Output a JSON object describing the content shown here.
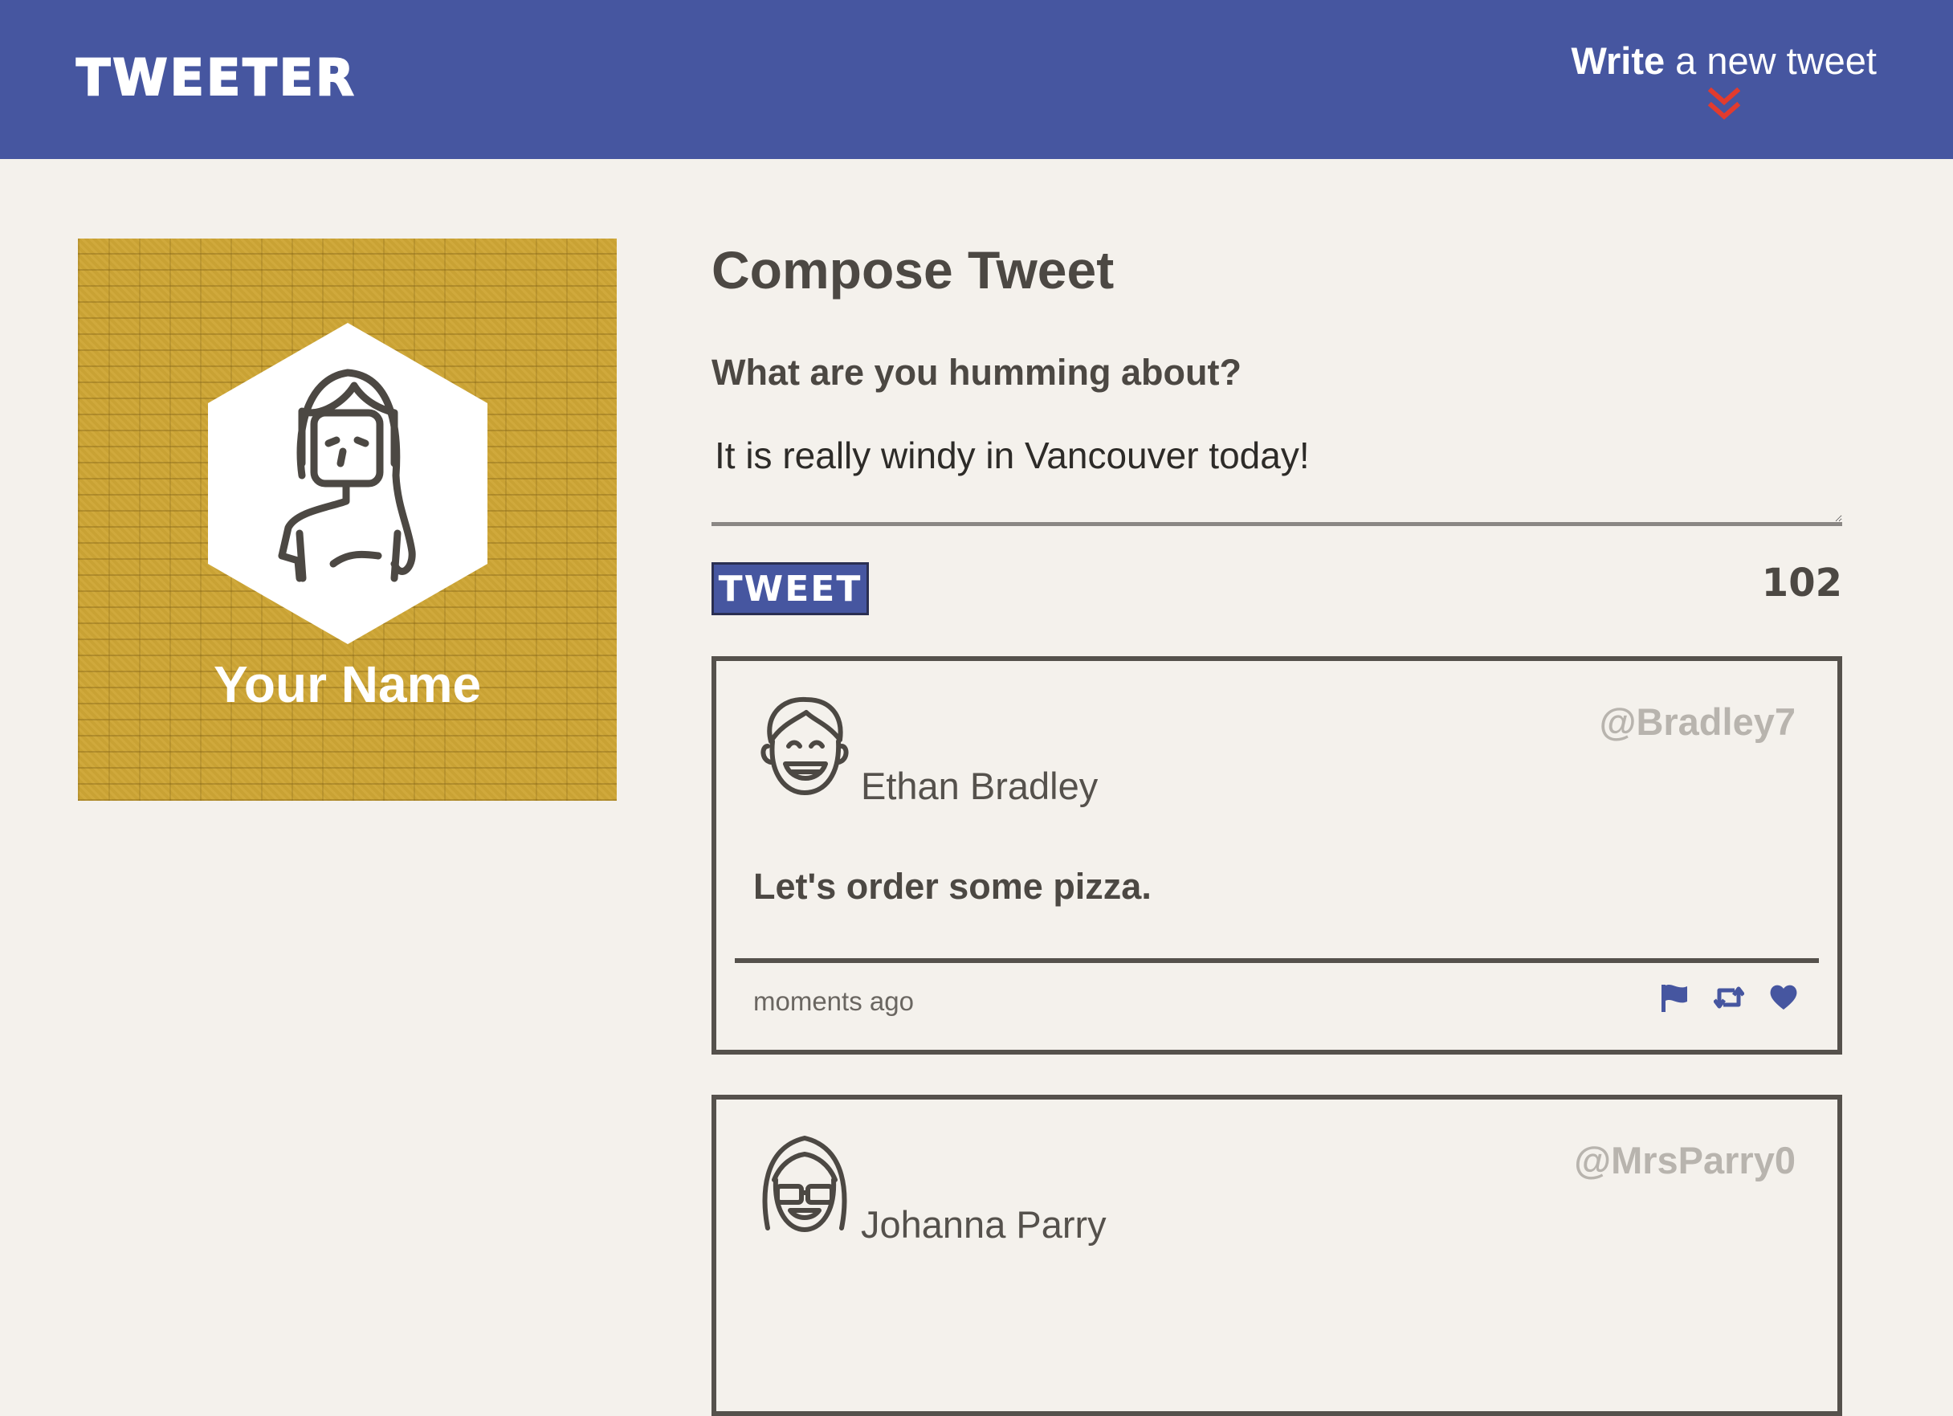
{
  "nav": {
    "brand": "TWEETER",
    "compose_bold": "Write",
    "compose_rest": " a new tweet",
    "arrow_icon": "double-chevron-down-icon"
  },
  "profile": {
    "name": "Your Name",
    "avatar_icon": "woman-avatar-icon"
  },
  "compose": {
    "title": "Compose Tweet",
    "label": "What are you humming about?",
    "text": "It is really windy in Vancouver today!",
    "button": "TWEET",
    "counter": "102"
  },
  "tweets": [
    {
      "name": "Ethan Bradley",
      "handle": "@Bradley7",
      "content": "Let's order some pizza.",
      "time": "moments ago",
      "avatar_icon": "smiling-man-avatar-icon"
    },
    {
      "name": "Johanna Parry",
      "handle": "@MrsParry0",
      "avatar_icon": "woman-with-glasses-avatar-icon"
    }
  ],
  "colors": {
    "header": "#4656a0",
    "accent_red": "#e23b2e",
    "background": "#f4f1ec",
    "profile_bg": "#c9a234",
    "action_icons": "#4656a0"
  }
}
